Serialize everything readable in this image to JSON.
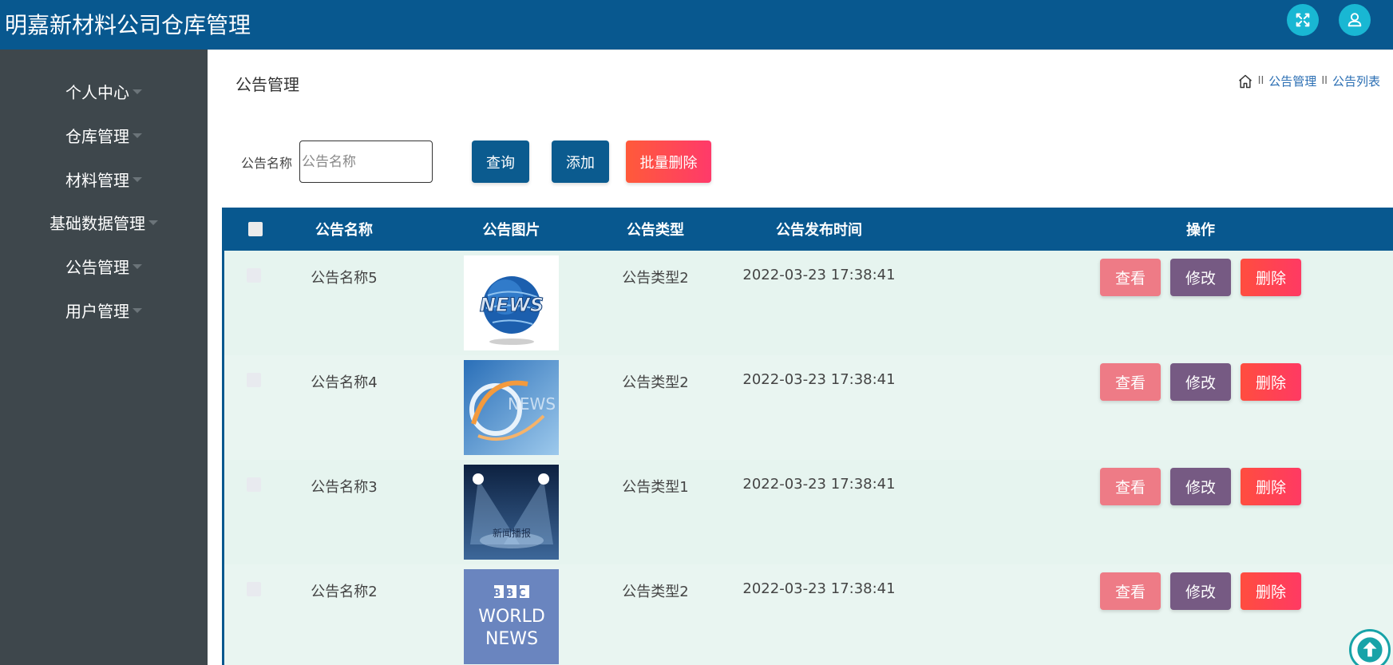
{
  "header": {
    "title": "明嘉新材料公司仓库管理",
    "fullscreen_icon": "expand-icon",
    "user_icon": "user-icon"
  },
  "sidebar": {
    "items": [
      {
        "label": "个人中心"
      },
      {
        "label": "仓库管理"
      },
      {
        "label": "材料管理"
      },
      {
        "label": "基础数据管理"
      },
      {
        "label": "公告管理"
      },
      {
        "label": "用户管理"
      }
    ]
  },
  "main": {
    "page_title": "公告管理",
    "breadcrumb": {
      "sep": "II",
      "items": [
        "公告管理",
        "公告列表"
      ]
    },
    "search": {
      "label": "公告名称",
      "placeholder": "公告名称"
    },
    "buttons": {
      "query": "查询",
      "add": "添加",
      "batch_delete": "批量删除"
    },
    "table": {
      "columns": [
        "公告名称",
        "公告图片",
        "公告类型",
        "公告发布时间",
        "操作"
      ],
      "rows": [
        {
          "name": "公告名称5",
          "type": "公告类型2",
          "time": "2022-03-23 17:38:41",
          "image": "news-globe"
        },
        {
          "name": "公告名称4",
          "type": "公告类型2",
          "time": "2022-03-23 17:38:41",
          "image": "news-abstract"
        },
        {
          "name": "公告名称3",
          "type": "公告类型1",
          "time": "2022-03-23 17:38:41",
          "image": "news-broadcast",
          "image_text": "新闻播报"
        },
        {
          "name": "公告名称2",
          "type": "公告类型2",
          "time": "2022-03-23 17:38:41",
          "image": "bbc-world-news",
          "image_text": [
            "BBC",
            "WORLD",
            "NEWS"
          ]
        }
      ],
      "actions": {
        "view": "查看",
        "edit": "修改",
        "delete": "删除"
      }
    }
  },
  "colors": {
    "header_bg": "#08588f",
    "sidebar_bg": "#3e474c",
    "row_bg": "#e5f4ef",
    "accent_cyan": "#19b7d3",
    "view_btn": "#ee7b86",
    "edit_btn": "#765a83",
    "delete_btn": "#ff4d3f"
  }
}
